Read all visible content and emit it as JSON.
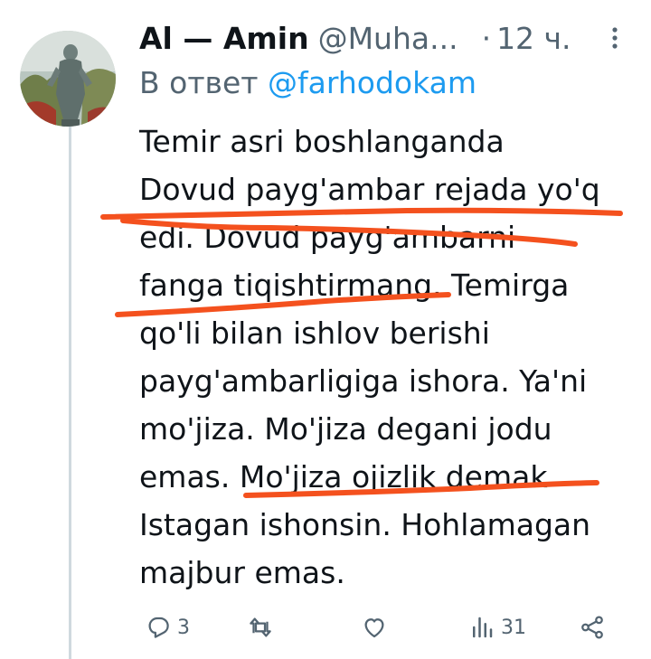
{
  "tweet": {
    "display_name": "Al — Amin",
    "handle": "@Muha...",
    "separator": "·",
    "time": "12 ч.",
    "reply_prefix": "В ответ",
    "reply_to": "@farhodokam",
    "text_lines": [
      "Temir asri boshlanganda",
      "Dovud payg'ambar rejada yo'q",
      "edi. Dovud payg'ambarni",
      "fanga tiqishtirmang. Temirga",
      "qo'li bilan ishlov berishi",
      "payg'ambarligiga ishora. Ya'ni",
      "mo'jiza. Mo'jiza degani jodu",
      "emas. Mo'jiza ojizlik demak",
      "Istagan ishonsin. Hohlamagan",
      "majbur emas."
    ]
  },
  "actions": {
    "reply": {
      "icon": "reply-icon",
      "count": "3"
    },
    "retweet": {
      "icon": "retweet-icon",
      "count": ""
    },
    "like": {
      "icon": "heart-icon",
      "count": ""
    },
    "views": {
      "icon": "views-icon",
      "count": "31"
    },
    "share": {
      "icon": "share-icon",
      "count": ""
    }
  },
  "colors": {
    "text": "#0f1419",
    "secondary": "#536471",
    "link": "#1d9bf0",
    "annotation": "#f4511e",
    "thread_line": "#cfd9de"
  }
}
